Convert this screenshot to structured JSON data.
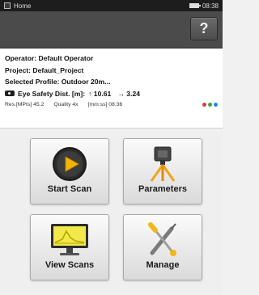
{
  "status_bar": {
    "title": "Home",
    "time": "08:38"
  },
  "header": {
    "help_label": "?"
  },
  "info": {
    "operator": "Operator: Default Operator",
    "project": "Project: Default_Project",
    "profile": "Selected Profile: Outdoor 20m...",
    "eye_safety_label": "Eye Safety Dist. [m]:",
    "eye_value_1": "↑ 10.61",
    "eye_value_2": "→ 3.24",
    "res": "Res.[MPts] 45.2",
    "quality": "Quality 4x",
    "duration": "[mm:ss] 08:36"
  },
  "colors": {
    "dot_red": "#e53935",
    "dot_green": "#43a047",
    "dot_blue": "#1e88e5",
    "play_yellow": "#f4b400"
  },
  "tiles": [
    {
      "label": "Start Scan",
      "icon": "play-icon"
    },
    {
      "label": "Parameters",
      "icon": "scanner-tripod-icon"
    },
    {
      "label": "View Scans",
      "icon": "monitor-chart-icon"
    },
    {
      "label": "Manage",
      "icon": "tools-icon"
    }
  ]
}
